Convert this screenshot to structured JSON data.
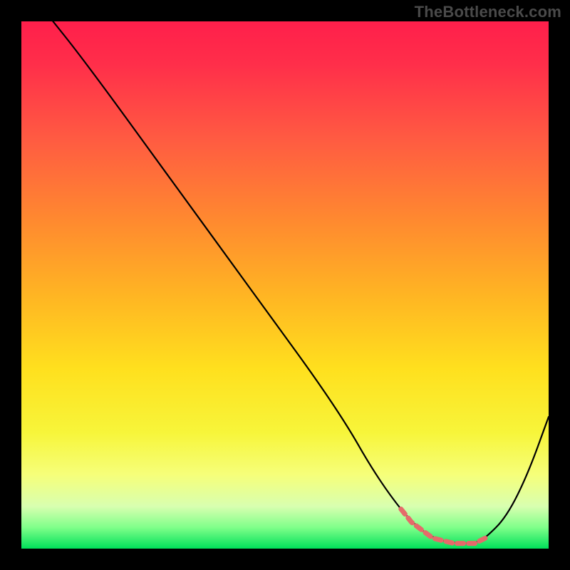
{
  "watermark": "TheBottleneck.com",
  "colors": {
    "page_bg": "#000000",
    "watermark": "#4a4a4a",
    "curve": "#000000",
    "highlight": "#e56a6a",
    "gradient_stops": [
      {
        "offset": 0.0,
        "color": "#ff1f4b"
      },
      {
        "offset": 0.08,
        "color": "#ff2e4a"
      },
      {
        "offset": 0.22,
        "color": "#ff5a42"
      },
      {
        "offset": 0.38,
        "color": "#ff8a2f"
      },
      {
        "offset": 0.52,
        "color": "#ffb523"
      },
      {
        "offset": 0.66,
        "color": "#ffe01e"
      },
      {
        "offset": 0.78,
        "color": "#f7f53a"
      },
      {
        "offset": 0.86,
        "color": "#f6ff7a"
      },
      {
        "offset": 0.92,
        "color": "#d8ffb0"
      },
      {
        "offset": 0.96,
        "color": "#7fff8a"
      },
      {
        "offset": 1.0,
        "color": "#00e05a"
      }
    ]
  },
  "chart_data": {
    "type": "line",
    "title": "",
    "xlabel": "",
    "ylabel": "",
    "xlim": [
      0,
      100
    ],
    "ylim": [
      0,
      100
    ],
    "x": [
      6,
      10,
      16,
      24,
      32,
      40,
      48,
      56,
      62,
      66,
      70,
      74,
      78,
      82,
      86,
      88,
      92,
      96,
      100
    ],
    "values": [
      100,
      95,
      87,
      76,
      65,
      54,
      43,
      32,
      23,
      16,
      10,
      5,
      2,
      1,
      1,
      2,
      6,
      14,
      25
    ],
    "highlight_range_x": [
      72,
      89
    ],
    "note": "x and y are in percent of plot width/height; y=0 is at the bottom (green) edge, y=100 at the top (red)."
  }
}
